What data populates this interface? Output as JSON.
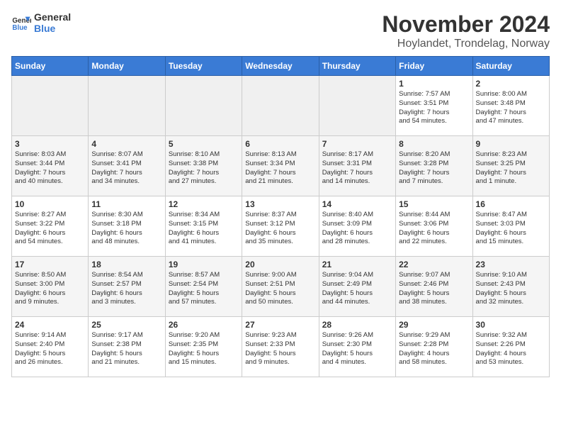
{
  "header": {
    "logo_line1": "General",
    "logo_line2": "Blue",
    "title": "November 2024",
    "subtitle": "Hoylandet, Trondelag, Norway"
  },
  "calendar": {
    "days_of_week": [
      "Sunday",
      "Monday",
      "Tuesday",
      "Wednesday",
      "Thursday",
      "Friday",
      "Saturday"
    ],
    "weeks": [
      [
        {
          "day": "",
          "content": ""
        },
        {
          "day": "",
          "content": ""
        },
        {
          "day": "",
          "content": ""
        },
        {
          "day": "",
          "content": ""
        },
        {
          "day": "",
          "content": ""
        },
        {
          "day": "1",
          "content": "Sunrise: 7:57 AM\nSunset: 3:51 PM\nDaylight: 7 hours\nand 54 minutes."
        },
        {
          "day": "2",
          "content": "Sunrise: 8:00 AM\nSunset: 3:48 PM\nDaylight: 7 hours\nand 47 minutes."
        }
      ],
      [
        {
          "day": "3",
          "content": "Sunrise: 8:03 AM\nSunset: 3:44 PM\nDaylight: 7 hours\nand 40 minutes."
        },
        {
          "day": "4",
          "content": "Sunrise: 8:07 AM\nSunset: 3:41 PM\nDaylight: 7 hours\nand 34 minutes."
        },
        {
          "day": "5",
          "content": "Sunrise: 8:10 AM\nSunset: 3:38 PM\nDaylight: 7 hours\nand 27 minutes."
        },
        {
          "day": "6",
          "content": "Sunrise: 8:13 AM\nSunset: 3:34 PM\nDaylight: 7 hours\nand 21 minutes."
        },
        {
          "day": "7",
          "content": "Sunrise: 8:17 AM\nSunset: 3:31 PM\nDaylight: 7 hours\nand 14 minutes."
        },
        {
          "day": "8",
          "content": "Sunrise: 8:20 AM\nSunset: 3:28 PM\nDaylight: 7 hours\nand 7 minutes."
        },
        {
          "day": "9",
          "content": "Sunrise: 8:23 AM\nSunset: 3:25 PM\nDaylight: 7 hours\nand 1 minute."
        }
      ],
      [
        {
          "day": "10",
          "content": "Sunrise: 8:27 AM\nSunset: 3:22 PM\nDaylight: 6 hours\nand 54 minutes."
        },
        {
          "day": "11",
          "content": "Sunrise: 8:30 AM\nSunset: 3:18 PM\nDaylight: 6 hours\nand 48 minutes."
        },
        {
          "day": "12",
          "content": "Sunrise: 8:34 AM\nSunset: 3:15 PM\nDaylight: 6 hours\nand 41 minutes."
        },
        {
          "day": "13",
          "content": "Sunrise: 8:37 AM\nSunset: 3:12 PM\nDaylight: 6 hours\nand 35 minutes."
        },
        {
          "day": "14",
          "content": "Sunrise: 8:40 AM\nSunset: 3:09 PM\nDaylight: 6 hours\nand 28 minutes."
        },
        {
          "day": "15",
          "content": "Sunrise: 8:44 AM\nSunset: 3:06 PM\nDaylight: 6 hours\nand 22 minutes."
        },
        {
          "day": "16",
          "content": "Sunrise: 8:47 AM\nSunset: 3:03 PM\nDaylight: 6 hours\nand 15 minutes."
        }
      ],
      [
        {
          "day": "17",
          "content": "Sunrise: 8:50 AM\nSunset: 3:00 PM\nDaylight: 6 hours\nand 9 minutes."
        },
        {
          "day": "18",
          "content": "Sunrise: 8:54 AM\nSunset: 2:57 PM\nDaylight: 6 hours\nand 3 minutes."
        },
        {
          "day": "19",
          "content": "Sunrise: 8:57 AM\nSunset: 2:54 PM\nDaylight: 5 hours\nand 57 minutes."
        },
        {
          "day": "20",
          "content": "Sunrise: 9:00 AM\nSunset: 2:51 PM\nDaylight: 5 hours\nand 50 minutes."
        },
        {
          "day": "21",
          "content": "Sunrise: 9:04 AM\nSunset: 2:49 PM\nDaylight: 5 hours\nand 44 minutes."
        },
        {
          "day": "22",
          "content": "Sunrise: 9:07 AM\nSunset: 2:46 PM\nDaylight: 5 hours\nand 38 minutes."
        },
        {
          "day": "23",
          "content": "Sunrise: 9:10 AM\nSunset: 2:43 PM\nDaylight: 5 hours\nand 32 minutes."
        }
      ],
      [
        {
          "day": "24",
          "content": "Sunrise: 9:14 AM\nSunset: 2:40 PM\nDaylight: 5 hours\nand 26 minutes."
        },
        {
          "day": "25",
          "content": "Sunrise: 9:17 AM\nSunset: 2:38 PM\nDaylight: 5 hours\nand 21 minutes."
        },
        {
          "day": "26",
          "content": "Sunrise: 9:20 AM\nSunset: 2:35 PM\nDaylight: 5 hours\nand 15 minutes."
        },
        {
          "day": "27",
          "content": "Sunrise: 9:23 AM\nSunset: 2:33 PM\nDaylight: 5 hours\nand 9 minutes."
        },
        {
          "day": "28",
          "content": "Sunrise: 9:26 AM\nSunset: 2:30 PM\nDaylight: 5 hours\nand 4 minutes."
        },
        {
          "day": "29",
          "content": "Sunrise: 9:29 AM\nSunset: 2:28 PM\nDaylight: 4 hours\nand 58 minutes."
        },
        {
          "day": "30",
          "content": "Sunrise: 9:32 AM\nSunset: 2:26 PM\nDaylight: 4 hours\nand 53 minutes."
        }
      ]
    ]
  }
}
